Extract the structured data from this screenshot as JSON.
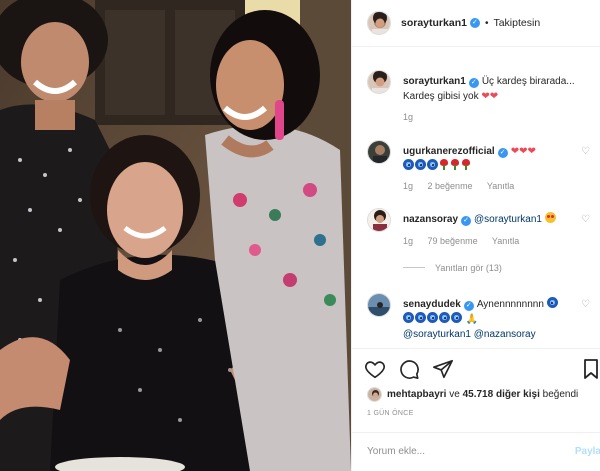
{
  "header": {
    "username": "sorayturkan1",
    "separator": "•",
    "follow_status": "Takiptesin"
  },
  "comments": [
    {
      "username": "sorayturkan1",
      "text": "Üç kardeş birarada... Kardeş gibisi yok",
      "emojis": "❤❤",
      "time": "1g"
    },
    {
      "username": "ugurkanerezofficial",
      "hearts": "❤❤❤",
      "time": "1g",
      "likes": "2 beğenme",
      "reply": "Yanıtla"
    },
    {
      "username": "nazansoray",
      "mention": "@sorayturkan1",
      "time": "1g",
      "likes": "79 beğenme",
      "reply": "Yanıtla",
      "view_replies": "Yanıtları gör (13)"
    },
    {
      "username": "senaydudek",
      "text": "Aynennnnnnnn",
      "mention1": "@sorayturkan1",
      "mention2": "@nazansoray"
    }
  ],
  "actions": {
    "liked_by_user": "mehtapbayri",
    "liked_by_connector": "ve",
    "liked_by_count": "45.718 diğer kişi",
    "liked_by_suffix": "beğendi",
    "time_ago": "1 GÜN ÖNCE",
    "comment_placeholder": "Yorum ekle...",
    "post_label": "Payla"
  },
  "icons": {
    "verified": "verified-badge-icon",
    "like": "heart-outline-icon",
    "comment": "speech-bubble-icon",
    "share": "paper-plane-icon",
    "save": "bookmark-icon"
  },
  "colors": {
    "verified_blue": "#3897f0",
    "heart_red": "#ed4956",
    "mention_blue": "#00376b",
    "muted_gray": "#8e8e8e",
    "post_button_disabled": "#b2dffc"
  }
}
